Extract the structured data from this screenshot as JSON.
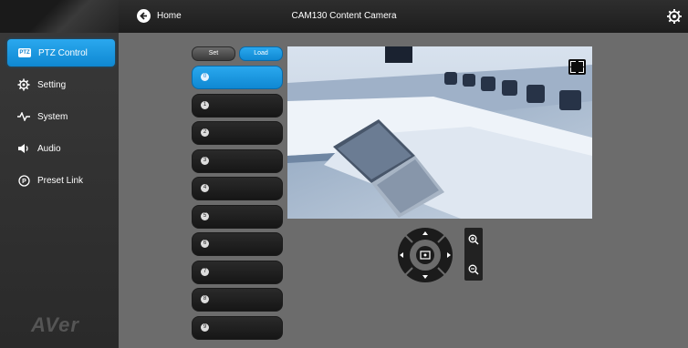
{
  "header": {
    "home_label": "Home",
    "camera_title": "CAM130 Content Camera"
  },
  "sidebar": {
    "items": [
      {
        "label": "PTZ Control",
        "icon": "ptz-icon",
        "active": true,
        "badge": "PTZ"
      },
      {
        "label": "Setting",
        "icon": "gear-icon",
        "active": false
      },
      {
        "label": "System",
        "icon": "pulse-icon",
        "active": false
      },
      {
        "label": "Audio",
        "icon": "speaker-icon",
        "active": false
      },
      {
        "label": "Preset Link",
        "icon": "preset-link-icon",
        "active": false
      }
    ],
    "logo": "AVer"
  },
  "preset_tabs": {
    "set_label": "Set",
    "load_label": "Load",
    "active": "Load"
  },
  "presets": [
    "0",
    "1",
    "2",
    "3",
    "4",
    "5",
    "6",
    "7",
    "8",
    "9"
  ],
  "active_preset": "0",
  "colors": {
    "accent": "#1a96e0",
    "background": "#6c6c6c",
    "sidebar": "#333333"
  }
}
